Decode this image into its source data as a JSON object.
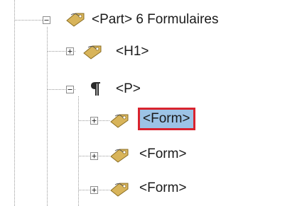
{
  "tree": {
    "nodes": [
      {
        "label": "<Part> 6 Formulaires",
        "icon": "tag-icon",
        "expander": "minus",
        "selected": false
      },
      {
        "label": "<H1>",
        "icon": "tag-icon",
        "expander": "plus",
        "selected": false
      },
      {
        "label": "<P>",
        "icon": "paragraph-icon",
        "expander": "minus",
        "selected": false
      },
      {
        "label": "<Form>",
        "icon": "tag-icon",
        "expander": "plus",
        "selected": true
      },
      {
        "label": "<Form>",
        "icon": "tag-icon",
        "expander": "plus",
        "selected": false
      },
      {
        "label": "<Form>",
        "icon": "tag-icon",
        "expander": "plus",
        "selected": false
      }
    ]
  },
  "colors": {
    "selection_background": "#9cc3e6",
    "selection_border": "#d9232e",
    "tag_icon": "#d8b45a"
  }
}
